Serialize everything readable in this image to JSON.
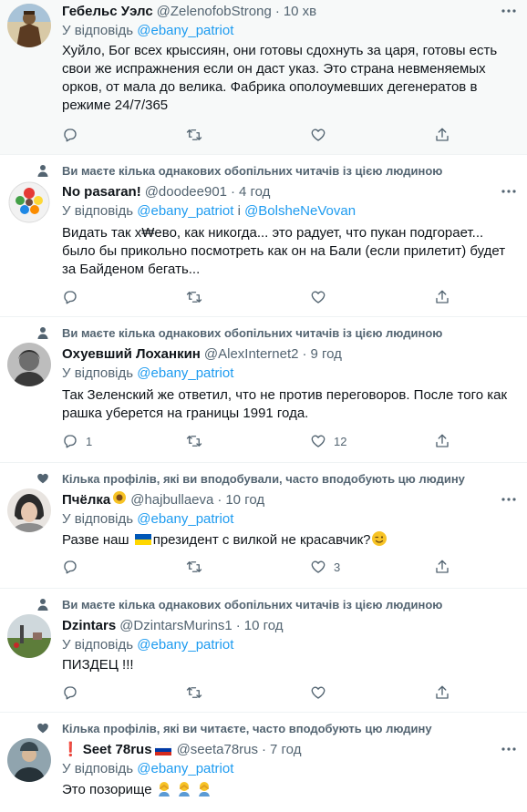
{
  "tweets": [
    {
      "social": "",
      "name": "Гебельс Уэлс",
      "handle": "@ZelenofobStrong",
      "time": "10 хв",
      "reply_prefix": "У відповідь",
      "reply_to": "@ebany_patriot",
      "reply_joiner": "",
      "reply_to_2": "",
      "body": "Хуйло, Бог всех крыссиян, они готовы сдохнуть за царя, готовы есть свои же испражнения если он даст указ. Это страна невменяемых орков, от мала до велика. Фабрика ополоумевших дегенератов в режиме 24/7/365",
      "reply_count": "",
      "retweet_count": "",
      "like_count": ""
    },
    {
      "social": "Ви маєте кілька однакових обопільних читачів із цією людиною",
      "name": "No pasaran!",
      "handle": "@doodee901",
      "time": "4 год",
      "reply_prefix": "У відповідь",
      "reply_to": "@ebany_patriot",
      "reply_joiner": " і ",
      "reply_to_2": "@BolsheNeVovan",
      "body": "Видать так х₩ево, как никогда... это радует, что пукан подгорает... было бы прикольно посмотреть как он на Бали (если прилетит) будет за Байденом бегать...",
      "reply_count": "",
      "retweet_count": "",
      "like_count": ""
    },
    {
      "social": "Ви маєте кілька однакових обопільних читачів із цією людиною",
      "name": "Охуевший Лоханкин",
      "handle": "@AlexInternet2",
      "time": "9 год",
      "reply_prefix": "У відповідь",
      "reply_to": "@ebany_patriot",
      "reply_joiner": "",
      "reply_to_2": "",
      "body": "Так Зеленский же ответил, что не против переговоров. После того как рашка уберется на границы 1991 года.",
      "reply_count": "1",
      "retweet_count": "",
      "like_count": "12"
    },
    {
      "social": "Кілька профілів, які ви вподобували, часто вподобують цю людину",
      "name": "Пчёлка",
      "handle": "@hajbullaeva",
      "time": "10 год",
      "reply_prefix": "У відповідь",
      "reply_to": "@ebany_patriot",
      "reply_joiner": "",
      "reply_to_2": "",
      "body_before": "Разве наш",
      "body_after": "президент с вилкой не красавчик?",
      "reply_count": "",
      "retweet_count": "",
      "like_count": "3"
    },
    {
      "social": "Ви маєте кілька однакових обопільних читачів із цією людиною",
      "name": "Dzintars",
      "handle": "@DzintarsMurins1",
      "time": "10 год",
      "reply_prefix": "У відповідь",
      "reply_to": "@ebany_patriot",
      "reply_joiner": "",
      "reply_to_2": "",
      "body": "ПИЗДЕЦ !!!",
      "reply_count": "",
      "retweet_count": "",
      "like_count": ""
    },
    {
      "social": "Кілька профілів, які ви читаєте, часто вподобують цю людину",
      "name_prefix": "❗",
      "name": "Seet 78rus",
      "handle": "@seeta78rus",
      "time": "7 год",
      "reply_prefix": "У відповідь",
      "reply_to": "@ebany_patriot",
      "reply_joiner": "",
      "reply_to_2": "",
      "body": "Это позорище",
      "reply_count": "",
      "retweet_count": "",
      "like_count": ""
    }
  ],
  "dot": "·",
  "colors": {
    "accent": "#1d9bf0",
    "muted": "#536471",
    "text": "#0f1419",
    "highlight_bg": "#f7f9f9"
  }
}
